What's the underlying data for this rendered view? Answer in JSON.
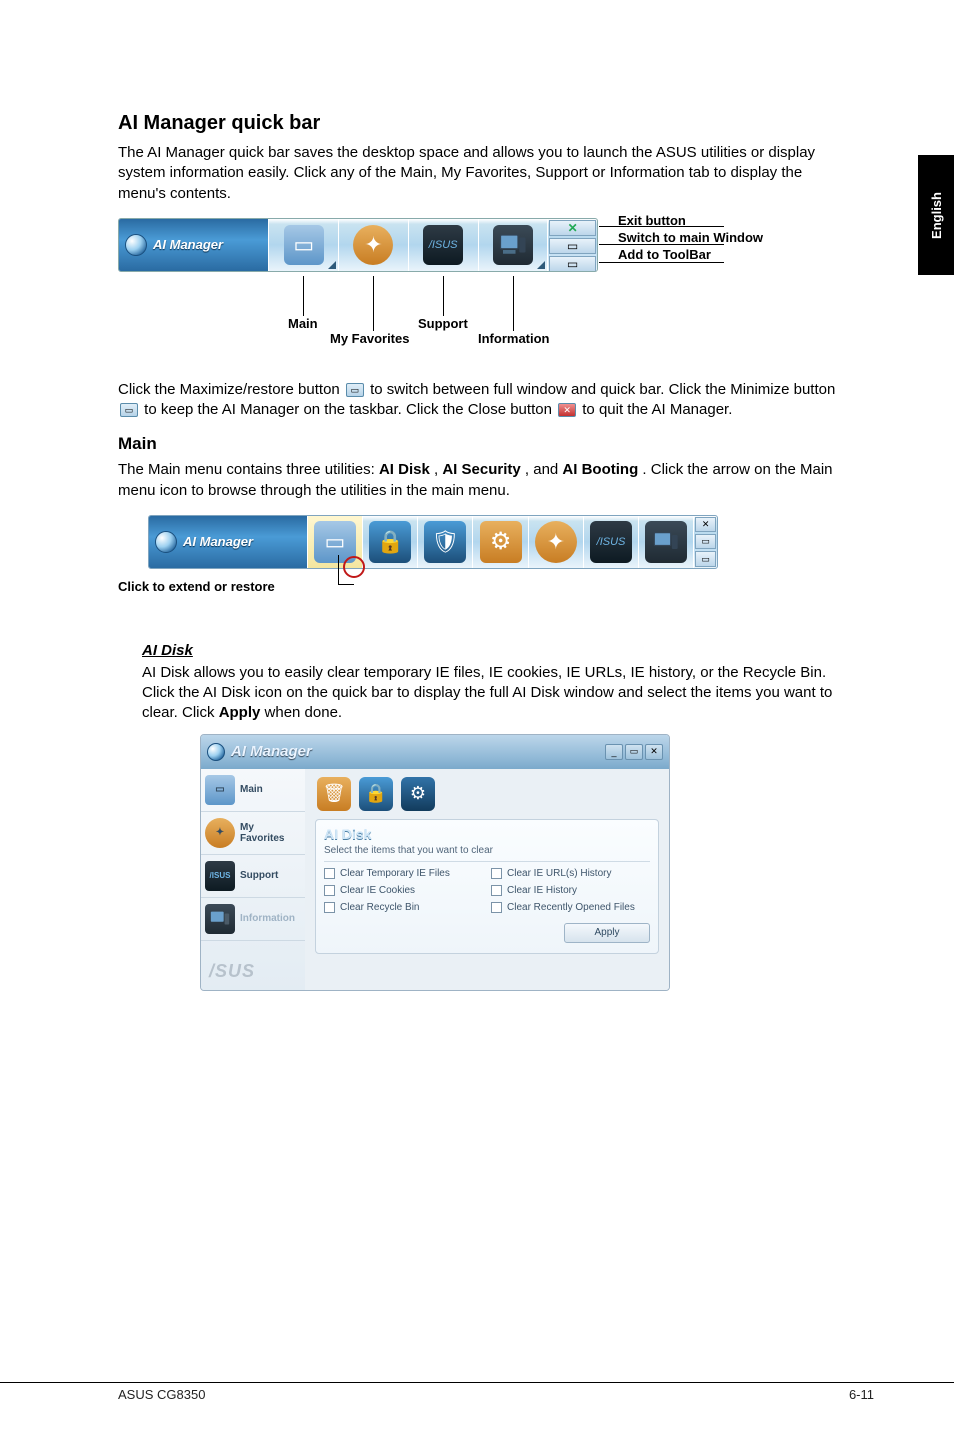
{
  "language_tab": "English",
  "section1": {
    "title": "AI Manager quick bar",
    "para": "The AI Manager quick bar saves the desktop space and allows you to launch the ASUS utilities or display system information easily. Click any of the Main, My Favorites, Support or Information tab to display the menu's contents."
  },
  "quickbar": {
    "brand": "AI Manager",
    "annotations": {
      "exit": "Exit button",
      "switch": "Switch to main Window",
      "add": "Add to ToolBar"
    },
    "labels": {
      "main": "Main",
      "fav": "My Favorites",
      "support": "Support",
      "info": "Information"
    }
  },
  "para_icons": {
    "t1a": "Click the Maximize/restore button ",
    "t1b": " to switch between full window and quick bar. Click the Minimize button ",
    "t1c": " to keep the AI Manager on the taskbar. Click the Close button ",
    "t1d": " to quit the AI Manager."
  },
  "main_section": {
    "heading": "Main",
    "para_a": "The Main menu contains three utilities: ",
    "b1": "AI Disk",
    "sep1": ", ",
    "b2": "AI Security",
    "sep2": ", and ",
    "b3": "AI Booting",
    "para_b": ". Click the arrow on the Main menu icon to browse through the utilities in the main menu."
  },
  "expbar": {
    "brand": "AI Manager",
    "caption": "Click to extend or restore"
  },
  "aidisk": {
    "heading": "AI Disk",
    "para_a": "AI Disk allows you to easily clear temporary IE files, IE cookies, IE URLs, IE history, or the Recycle Bin. Click the AI Disk icon on the quick bar to display the full AI Disk window and select the items you want to clear. Click ",
    "bold": "Apply",
    "para_b": " when done.",
    "window": {
      "title": "AI Manager",
      "side": {
        "main": "Main",
        "fav": "My\nFavorites",
        "support": "Support",
        "info": "Information",
        "logo": "/SUS"
      },
      "panel_title": "AI Disk",
      "panel_sub": "Select the items that you want to clear",
      "checks": {
        "c1": "Clear Temporary IE Files",
        "c2": "Clear IE URL(s) History",
        "c3": "Clear IE Cookies",
        "c4": "Clear IE History",
        "c5": "Clear Recycle Bin",
        "c6": "Clear Recently Opened Files"
      },
      "apply": "Apply"
    }
  },
  "footer": {
    "left": "ASUS CG8350",
    "right": "6-11"
  }
}
